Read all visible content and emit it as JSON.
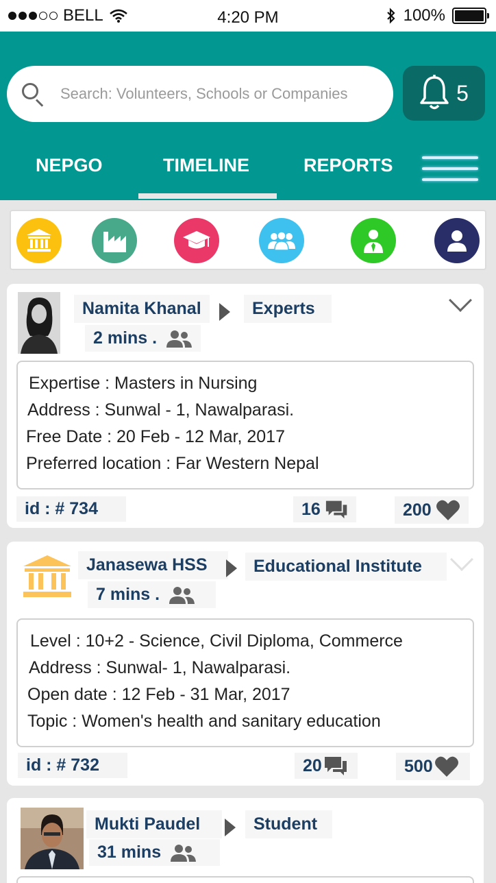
{
  "status_bar": {
    "carrier": "BELL",
    "time": "4:20 PM",
    "battery": "100%"
  },
  "search": {
    "placeholder": "Search:  Volunteers, Schools or Companies"
  },
  "notifications": {
    "count": "5"
  },
  "tabs": [
    {
      "label": "NEPGO"
    },
    {
      "label": "TIMELINE",
      "active": true
    },
    {
      "label": "REPORTS"
    }
  ],
  "categories": [
    {
      "icon": "bank-icon",
      "color": "#fcc10e"
    },
    {
      "icon": "factory-icon",
      "color": "#48a88a"
    },
    {
      "icon": "graduation-cap-icon",
      "color": "#ea3868"
    },
    {
      "icon": "group-icon",
      "color": "#3fc1ef"
    },
    {
      "icon": "professional-icon",
      "color": "#2ec926"
    },
    {
      "icon": "user-icon",
      "color": "#2a2e68"
    }
  ],
  "posts": [
    {
      "name": "Namita Khanal",
      "category": "Experts",
      "time": "2 mins .",
      "details": [
        "Expertise :  Masters in Nursing",
        "Address :  Sunwal - 1, Nawalparasi.",
        "Free Date : 20 Feb - 12 Mar, 2017",
        "Preferred location : Far Western Nepal"
      ],
      "id": "id : # 734",
      "comments": "16",
      "likes": "200"
    },
    {
      "name": "Janasewa HSS",
      "category": "Educational Institute",
      "time": "7 mins .",
      "details": [
        "Level :  10+2 - Science, Civil Diploma, Commerce",
        "Address :  Sunwal- 1, Nawalparasi.",
        "Open date : 12 Feb - 31 Mar, 2017",
        "Topic : Women's health and sanitary education"
      ],
      "id": "id : # 732",
      "comments": "20",
      "likes": "500"
    },
    {
      "name": "Mukti Paudel",
      "category": "Student",
      "time": "31 mins"
    }
  ],
  "colors": {
    "header": "#029790",
    "notification_bg": "#0a6b66",
    "text_blue": "#1c3e63"
  }
}
